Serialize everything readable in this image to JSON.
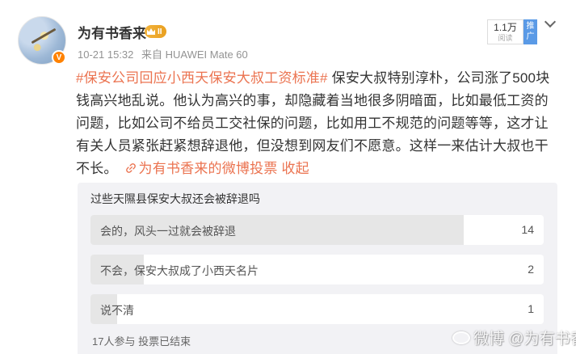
{
  "post": {
    "author": "为有书香来",
    "level_badge": "II",
    "time": "10-21 15:32",
    "source": "来自 HUAWEI Mate 60",
    "read_count": "1.1万",
    "read_label": "阅读",
    "promote_label": "推广",
    "topic": "#保安公司回应小西天保安大叔工资标准#",
    "body": " 保安大叔特别淳朴，公司涨了500块钱高兴地乱说。他认为高兴的事，却隐藏着当地很多阴暗面，比如最低工资的问题，比如公司不给员工交社保的问题，比如用工不规范的问题等等，这才让有关人员紧张赶紧想辞退他，但没想到网友们不愿意。这样一来估计大叔也干不长。",
    "link_text": "为有书香来的微博投票",
    "collapse_label": "收起"
  },
  "vote": {
    "title": "过些天隰县保安大叔还会被辞退吗",
    "options": [
      {
        "label": "会的，风头一过就会被辞退",
        "count": "14",
        "share": 0.8235
      },
      {
        "label": "不会，保安大叔成了小西天名片",
        "count": "2",
        "share": 0.1176
      },
      {
        "label": "说不清",
        "count": "1",
        "share": 0.0588
      }
    ],
    "footer": "17人参与 投票已结束"
  },
  "watermark": "微博 @为有书香来",
  "icons": {
    "verified": "verified-v-icon",
    "link": "link-icon",
    "menu": "chevron-down-icon"
  },
  "colors": {
    "accent": "#eb7350",
    "verified": "#ff8200",
    "promote": "#5a9ae6"
  }
}
